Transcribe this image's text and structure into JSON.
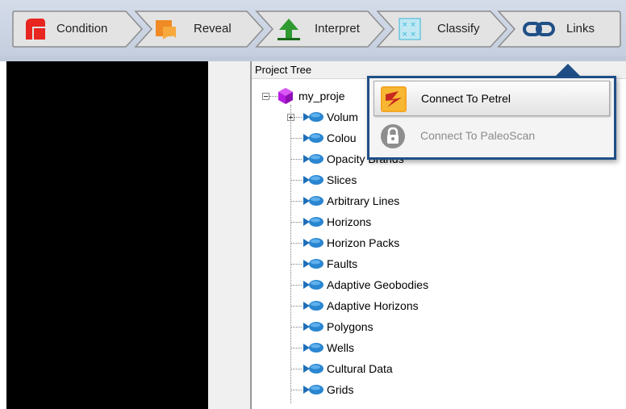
{
  "toolbar": {
    "steps": [
      {
        "label": "Condition",
        "icon": "condition-icon"
      },
      {
        "label": "Reveal",
        "icon": "reveal-icon"
      },
      {
        "label": "Interpret",
        "icon": "interpret-arrow-icon"
      },
      {
        "label": "Classify",
        "icon": "classify-icon"
      },
      {
        "label": "Links",
        "icon": "links-icon"
      }
    ],
    "colors": {
      "active_link": "#1f4f86",
      "condition": "#e8251f",
      "reveal": "#f08a24",
      "interpret": "#2f9a2f",
      "classify": "#37b6d8"
    }
  },
  "project_tree": {
    "header": "Project Tree",
    "root": {
      "label": "my_proje",
      "icon": "purple-cube-icon"
    },
    "items": [
      {
        "label": "Volum",
        "expandable": true
      },
      {
        "label": "Colou",
        "expandable": false
      },
      {
        "label": "Opacity Brands",
        "expandable": false
      },
      {
        "label": "Slices",
        "expandable": false
      },
      {
        "label": "Arbitrary Lines",
        "expandable": false
      },
      {
        "label": "Horizons",
        "expandable": false
      },
      {
        "label": "Horizon Packs",
        "expandable": false
      },
      {
        "label": "Faults",
        "expandable": false
      },
      {
        "label": "Adaptive Geobodies",
        "expandable": false
      },
      {
        "label": "Adaptive Horizons",
        "expandable": false
      },
      {
        "label": "Polygons",
        "expandable": false
      },
      {
        "label": "Wells",
        "expandable": false
      },
      {
        "label": "Cultural Data",
        "expandable": false
      },
      {
        "label": "Grids",
        "expandable": false
      }
    ]
  },
  "links_menu": {
    "items": [
      {
        "label": "Connect To Petrel",
        "icon": "petrel-icon",
        "enabled": true
      },
      {
        "label": "Connect To PaleoScan",
        "icon": "lock-icon",
        "enabled": false
      }
    ]
  }
}
